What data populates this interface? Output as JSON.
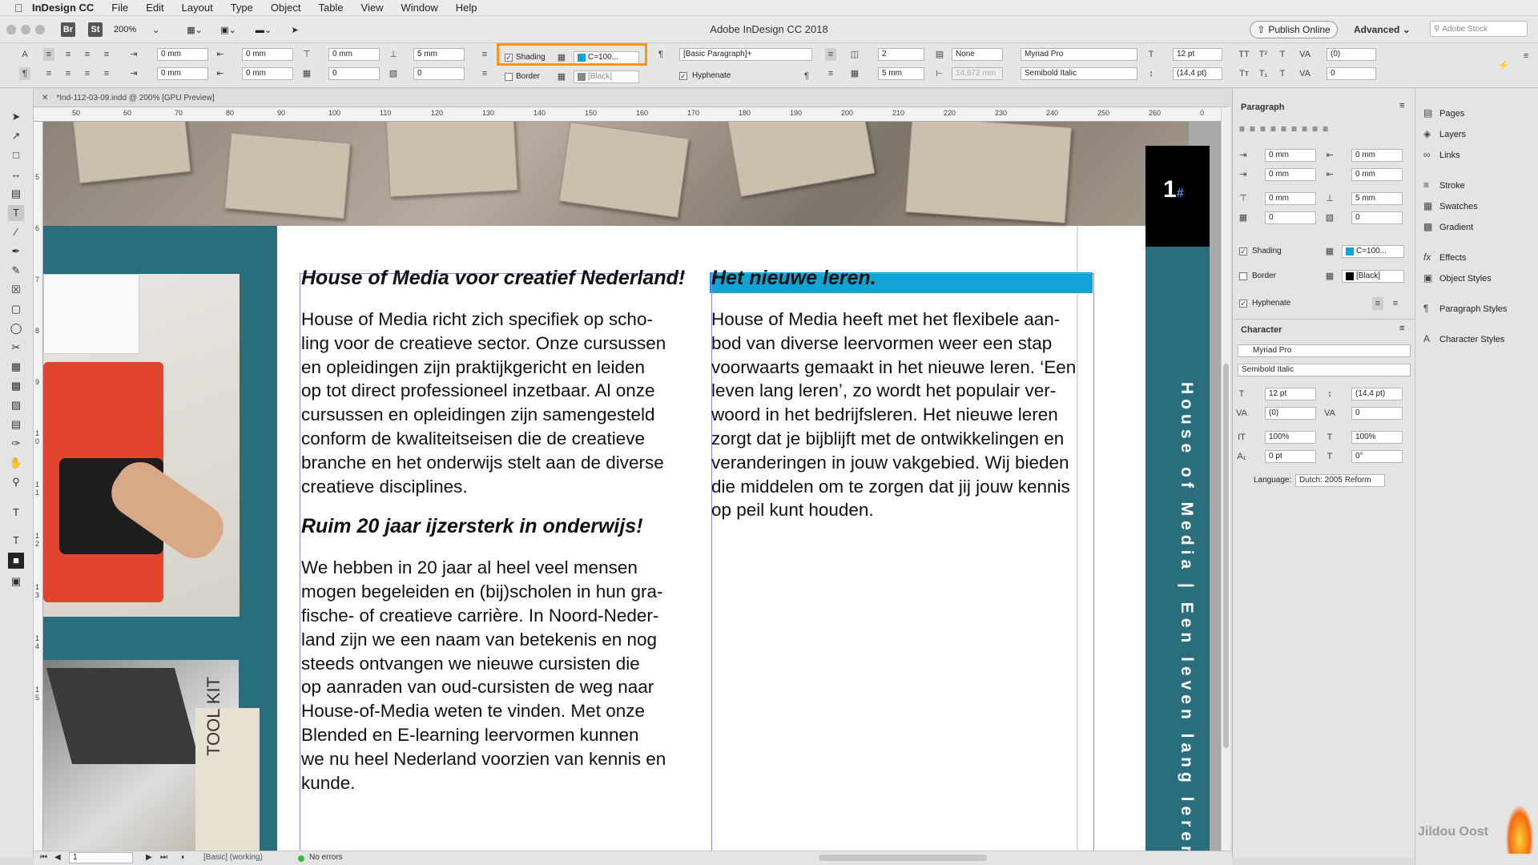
{
  "menubar": {
    "app": "InDesign CC",
    "items": [
      "File",
      "Edit",
      "Layout",
      "Type",
      "Object",
      "Table",
      "View",
      "Window",
      "Help"
    ]
  },
  "titlebar": {
    "title": "Adobe InDesign CC 2018",
    "zoom": "200%",
    "br": "Br",
    "st": "St",
    "publish": "Publish Online",
    "workspace": "Advanced",
    "stock_placeholder": "Adobe Stock"
  },
  "control": {
    "indent_left": "0 mm",
    "indent_first": "0 mm",
    "space_before": "0 mm",
    "space_after": "5 mm",
    "indent_right": "0 mm",
    "indent_last": "0 mm",
    "drop_lines": "0",
    "drop_chars": "0",
    "shading_label": "Shading",
    "shading_color": "C=100...",
    "border_label": "Border",
    "border_color": "[Black]",
    "para_style": "[Basic Paragraph]+",
    "hyphenate": "Hyphenate",
    "columns": "2",
    "gutter": "5 mm",
    "span": "None",
    "gutter_width": "14,672 mm",
    "font_family": "Myriad Pro",
    "font_style": "Semibold Italic",
    "font_size": "12 pt",
    "leading": "(14,4 pt)",
    "kerning": "(0)",
    "tracking": "0"
  },
  "document": {
    "tab": "*Ind-112-03-09.indd @ 200% [GPU Preview]",
    "ruler_marks": [
      "50",
      "60",
      "70",
      "80",
      "90",
      "100",
      "110",
      "120",
      "130",
      "140",
      "150",
      "160",
      "170",
      "180",
      "190",
      "200",
      "210",
      "220",
      "230",
      "240",
      "250",
      "260",
      "0"
    ],
    "vruler_marks": [
      "5",
      "6",
      "7",
      "8",
      "9",
      "1 0",
      "1 1",
      "1 2",
      "1 3",
      "1 4",
      "1 5"
    ],
    "page_number": "1",
    "page_marker": "#",
    "vertical_text": "House of Media | Een leven lang leren",
    "tool_kit": "TOOL KIT",
    "col1": {
      "h1": "House of Media voor creatief Nederland!",
      "p1": [
        "House of Media richt zich specifiek op scho-",
        "ling voor de creatieve sector. Onze cursussen",
        "en opleidingen zijn praktijkgericht en leiden",
        "op tot direct professioneel inzetbaar. Al onze",
        "cursussen en opleidingen zijn samengesteld",
        "conform de kwaliteitseisen die de creatieve",
        "branche en het onderwijs stelt aan de diverse",
        "creatieve disciplines."
      ],
      "h2": "Ruim 20 jaar ijzersterk in onderwijs!",
      "p2": [
        "We hebben in 20 jaar al heel veel mensen",
        "mogen begeleiden en (bij)scholen in hun gra-",
        "fische- of creatieve carrière. In Noord-Neder-",
        "land zijn we een naam van betekenis en nog",
        "steeds ontvangen we nieuwe cursisten die",
        "op aanraden van oud-cursisten de weg naar",
        "House-of-Media weten te vinden. Met onze",
        "Blended en E-learning leervormen kunnen",
        "we nu heel Nederland voorzien van kennis en",
        "kunde."
      ]
    },
    "col2": {
      "h1": "Het nieuwe leren.",
      "p1": [
        "House of Media heeft met het flexibele aan-",
        "bod van diverse leervormen weer een stap",
        "voorwaarts gemaakt in het nieuwe leren. ‘Een",
        "leven lang leren’, zo wordt het populair ver-",
        "woord in het bedrijfsleren. Het nieuwe leren",
        "zorgt dat je bijblijft met de ontwikkelingen en",
        "veranderingen in jouw vakgebied. Wij bieden",
        "die middelen om te zorgen dat jij jouw kennis",
        "op peil kunt houden."
      ]
    }
  },
  "status": {
    "page": "1",
    "style": "[Basic] (working)",
    "errors": "No errors"
  },
  "paragraph_panel": {
    "title": "Paragraph",
    "indent_left": "0 mm",
    "indent_right": "0 mm",
    "indent_first": "0 mm",
    "indent_last": "0 mm",
    "space_before": "0 mm",
    "space_after": "5 mm",
    "drop_lines": "0",
    "drop_chars": "0",
    "shading": "Shading",
    "shading_color": "C=100...",
    "border": "Border",
    "border_color": "[Black]",
    "hyphenate": "Hyphenate"
  },
  "character_panel": {
    "title": "Character",
    "font_family": "Myriad Pro",
    "font_style": "Semibold Italic",
    "size": "12 pt",
    "leading": "(14,4 pt)",
    "kerning": "(0)",
    "tracking": "0",
    "vscale": "100%",
    "hscale": "100%",
    "baseline": "0 pt",
    "skew": "0°",
    "language_label": "Language:",
    "language": "Dutch: 2005 Reform"
  },
  "right_panel": {
    "items": [
      "Pages",
      "Layers",
      "Links",
      "Stroke",
      "Swatches",
      "Gradient",
      "Effects",
      "Object Styles",
      "Paragraph Styles",
      "Character Styles"
    ]
  },
  "watermark": "Jildou Oost",
  "colors": {
    "accent_teal": "#2a6d7c",
    "shading_cyan": "#10a3d3",
    "highlight_orange": "#f7961d"
  }
}
